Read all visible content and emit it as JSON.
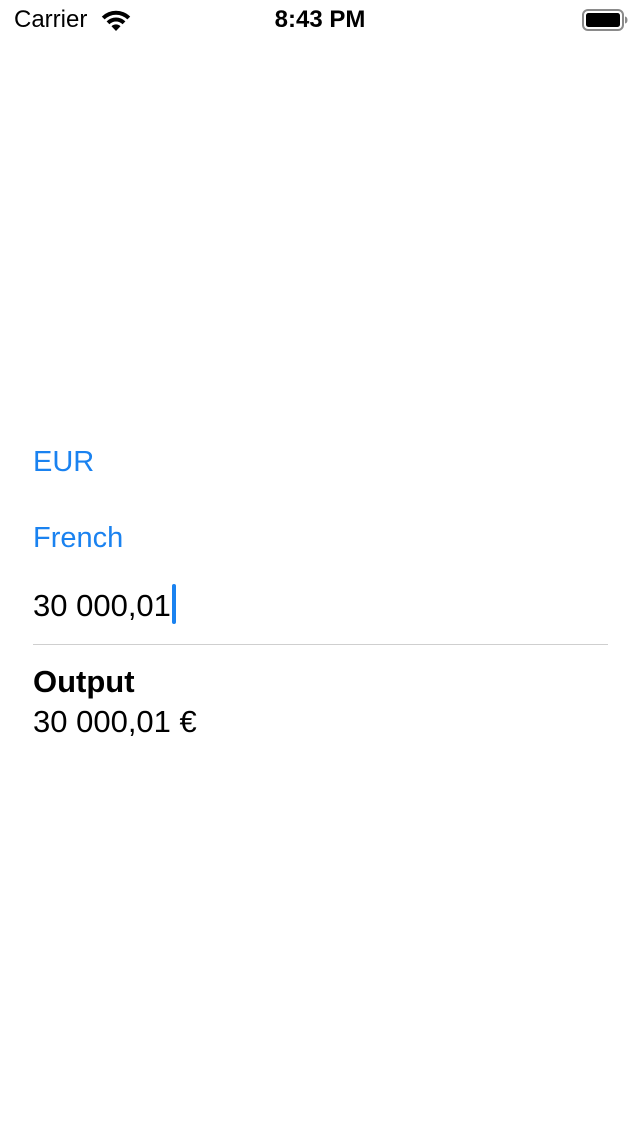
{
  "status_bar": {
    "carrier": "Carrier",
    "time": "8:43 PM",
    "wifi_icon": "wifi-icon",
    "battery_icon": "battery-icon"
  },
  "form": {
    "currency": "EUR",
    "locale": "French",
    "amount_value": "30 000,01"
  },
  "output": {
    "label": "Output",
    "value": "30 000,01 €"
  },
  "colors": {
    "accent": "#1a82f0",
    "divider": "#cfcfcf",
    "text": "#000000",
    "background": "#ffffff"
  }
}
